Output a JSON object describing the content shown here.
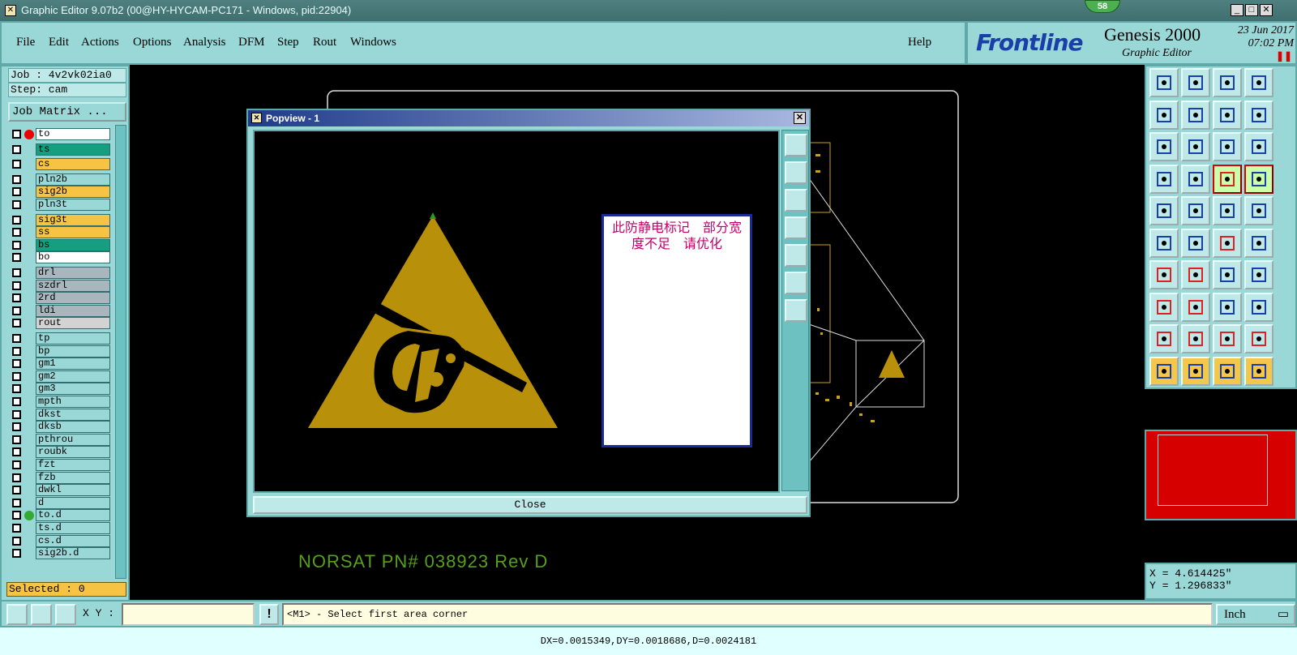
{
  "window": {
    "title": "Graphic Editor 9.07b2 (00@HY-HYCAM-PC171 - Windows, pid:22904)",
    "badge": "58"
  },
  "menu": {
    "items": [
      "File",
      "Edit",
      "Actions",
      "Options",
      "Analysis",
      "DFM",
      "Step",
      "Rout",
      "Windows"
    ],
    "help": "Help"
  },
  "brand": {
    "logo": "Frontline",
    "product": "Genesis 2000",
    "subtitle": "Graphic Editor",
    "date": "23 Jun 2017",
    "time": "07:02 PM"
  },
  "left": {
    "job": "Job : 4v2vk02ia0",
    "step": "Step: cam",
    "job_matrix": "Job Matrix ...",
    "selected": "Selected : 0",
    "layers": [
      {
        "name": "to",
        "color": "#ffffff"
      },
      {
        "name": "ts",
        "color": "#169e80"
      },
      {
        "name": "cs",
        "color": "#f6c344"
      },
      {
        "name": "pln2b",
        "color": "#9ad8d8"
      },
      {
        "name": "sig2b",
        "color": "#f6c344"
      },
      {
        "name": "pln3t",
        "color": "#9ad8d8"
      },
      {
        "name": "sig3t",
        "color": "#f6c344"
      },
      {
        "name": "ss",
        "color": "#f6c344"
      },
      {
        "name": "bs",
        "color": "#169e80"
      },
      {
        "name": "bo",
        "color": "#ffffff"
      },
      {
        "name": "drl",
        "color": "#a9b6bd"
      },
      {
        "name": "szdrl",
        "color": "#a9b6bd"
      },
      {
        "name": "2rd",
        "color": "#a9b6bd"
      },
      {
        "name": "ldi",
        "color": "#a9b6bd"
      },
      {
        "name": "rout",
        "color": "#d3d3d3"
      },
      {
        "name": "tp",
        "color": "#9ad8d8"
      },
      {
        "name": "bp",
        "color": "#9ad8d8"
      },
      {
        "name": "gm1",
        "color": "#9ad8d8"
      },
      {
        "name": "gm2",
        "color": "#9ad8d8"
      },
      {
        "name": "gm3",
        "color": "#9ad8d8"
      },
      {
        "name": "mpth",
        "color": "#9ad8d8"
      },
      {
        "name": "dkst",
        "color": "#9ad8d8"
      },
      {
        "name": "dksb",
        "color": "#9ad8d8"
      },
      {
        "name": "pthrou",
        "color": "#9ad8d8"
      },
      {
        "name": "roubk",
        "color": "#9ad8d8"
      },
      {
        "name": "fzt",
        "color": "#9ad8d8"
      },
      {
        "name": "fzb",
        "color": "#9ad8d8"
      },
      {
        "name": "dwkl",
        "color": "#9ad8d8"
      },
      {
        "name": "d",
        "color": "#9ad8d8"
      },
      {
        "name": "to.d",
        "color": "#9ad8d8"
      },
      {
        "name": "ts.d",
        "color": "#9ad8d8"
      },
      {
        "name": "cs.d",
        "color": "#9ad8d8"
      },
      {
        "name": "sig2b.d",
        "color": "#9ad8d8"
      }
    ]
  },
  "popup": {
    "title": "Popview - 1",
    "note": "此防静电标记　部分宽度不足　请优化",
    "close_label": "Close"
  },
  "canvas": {
    "label": "NORSAT PN# 038923 Rev D"
  },
  "coords": {
    "x": "X = 4.614425\"",
    "y": "Y = 1.296833\""
  },
  "bottom": {
    "xy_label": "X Y :",
    "xy_value": "",
    "prompt": "<M1> - Select first area corner",
    "units": "Inch",
    "status": "DX=0.0015349,DY=0.0018686,D=0.0024181"
  }
}
